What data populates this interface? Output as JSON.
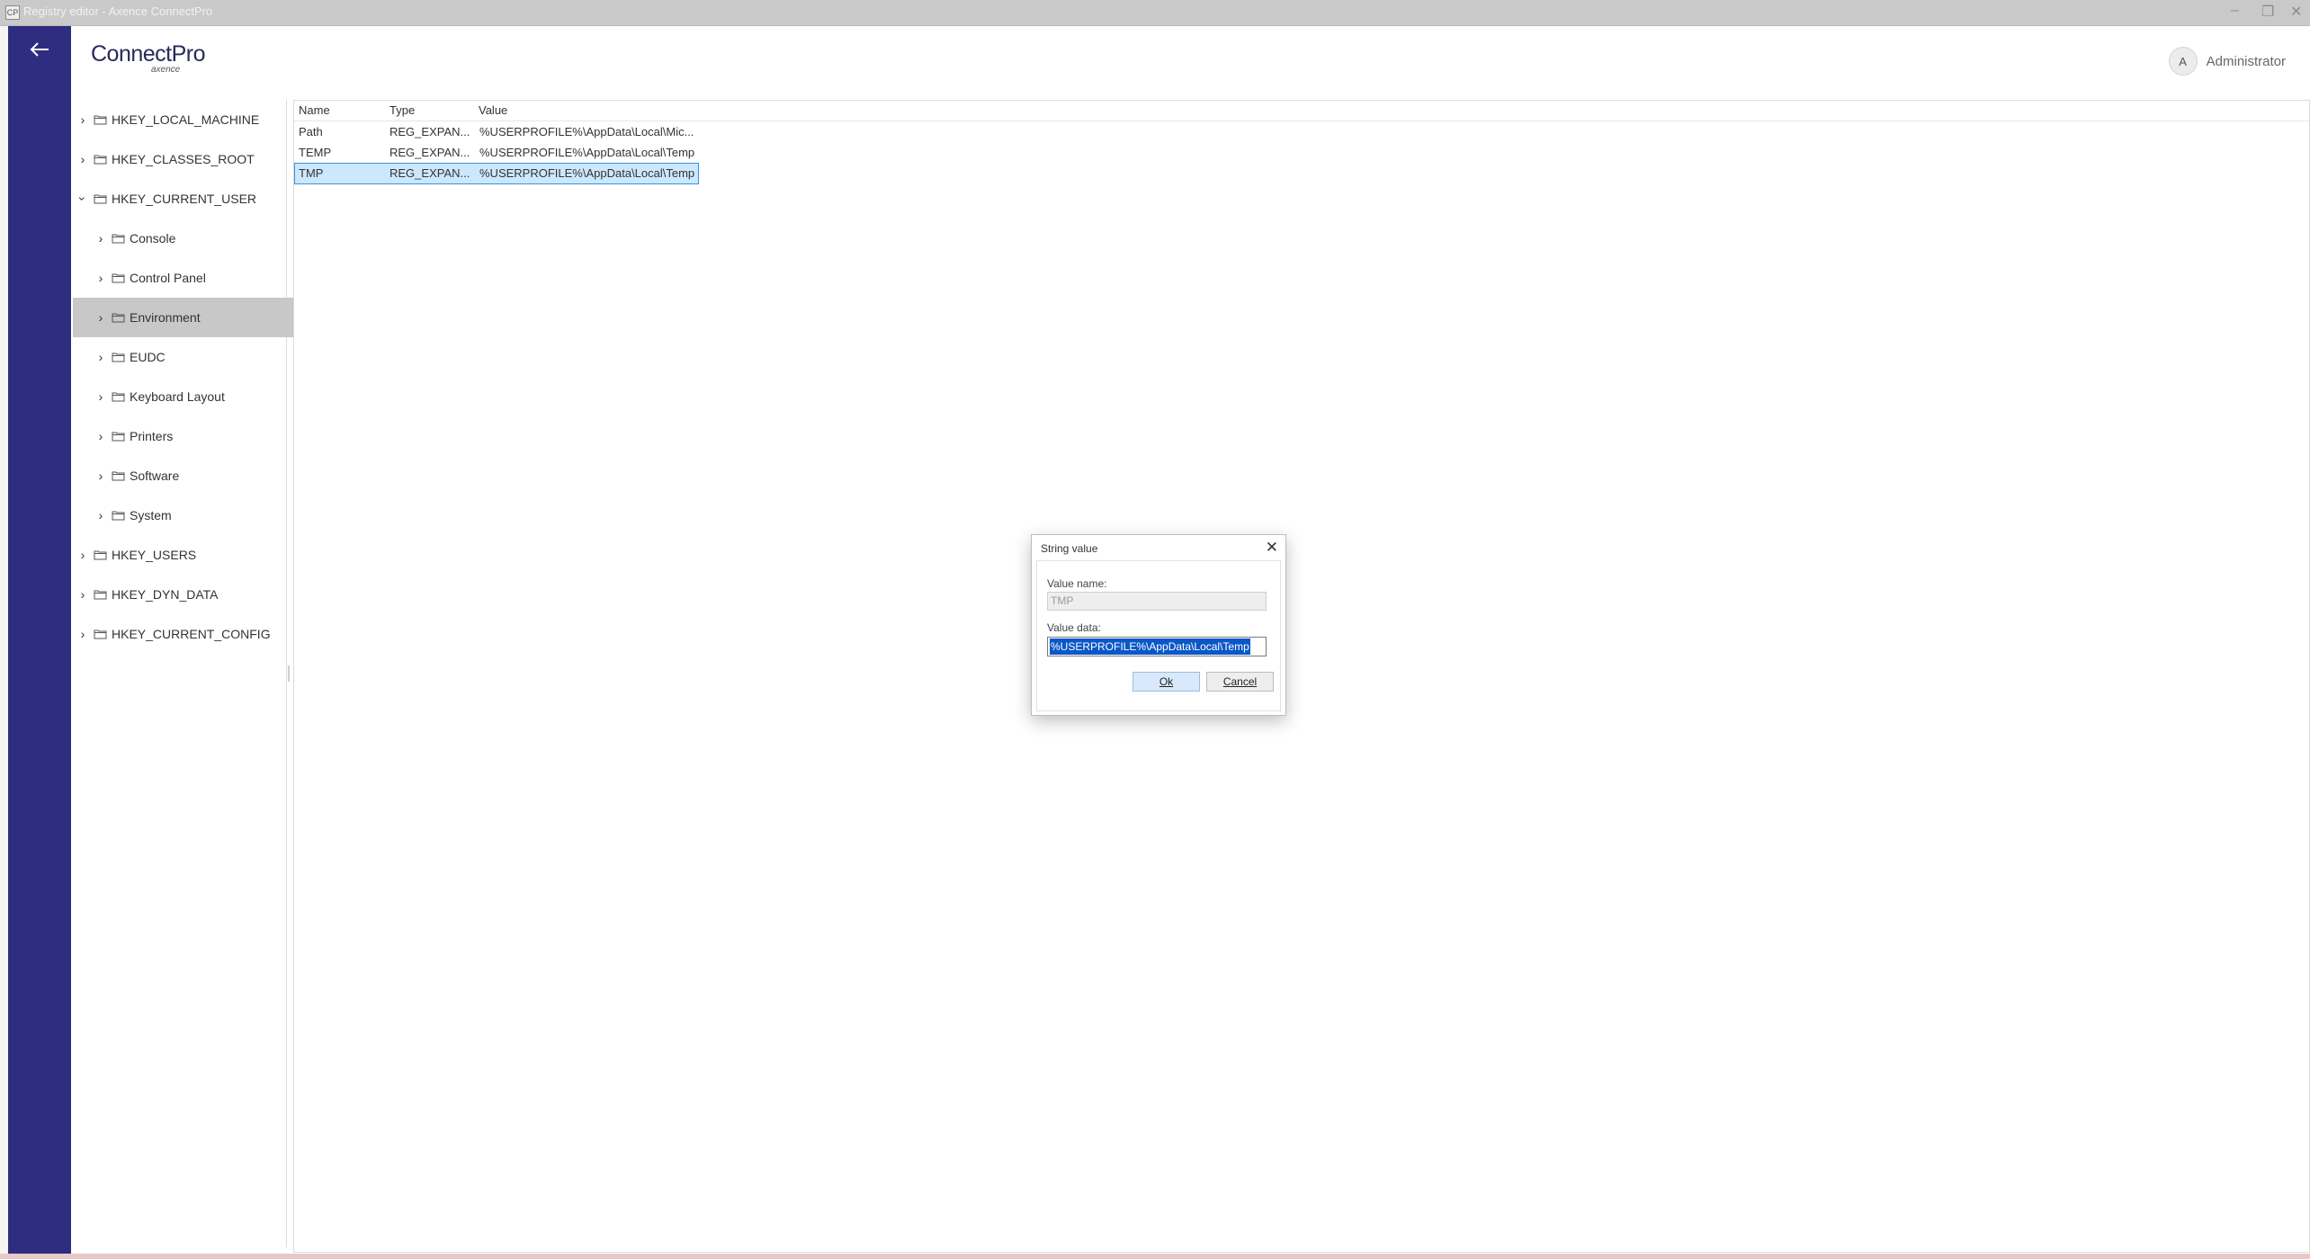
{
  "window": {
    "title": "Registry editor - Axence ConnectPro",
    "app_icon_text": "CP",
    "controls": [
      "minimize",
      "restore",
      "close"
    ]
  },
  "header": {
    "brand": "ConnectPro",
    "brand_sub": "axence",
    "user_initial": "A",
    "user_name": "Administrator"
  },
  "tree": {
    "items": [
      {
        "label": "HKEY_LOCAL_MACHINE",
        "level": 0,
        "expanded": false
      },
      {
        "label": "HKEY_CLASSES_ROOT",
        "level": 0,
        "expanded": false
      },
      {
        "label": "HKEY_CURRENT_USER",
        "level": 0,
        "expanded": true
      },
      {
        "label": "Console",
        "level": 1,
        "expanded": false
      },
      {
        "label": "Control Panel",
        "level": 1,
        "expanded": false
      },
      {
        "label": "Environment",
        "level": 1,
        "expanded": false,
        "selected": true
      },
      {
        "label": "EUDC",
        "level": 1,
        "expanded": false
      },
      {
        "label": "Keyboard Layout",
        "level": 1,
        "expanded": false
      },
      {
        "label": "Printers",
        "level": 1,
        "expanded": false
      },
      {
        "label": "Software",
        "level": 1,
        "expanded": false
      },
      {
        "label": "System",
        "level": 1,
        "expanded": false
      },
      {
        "label": "HKEY_USERS",
        "level": 0,
        "expanded": false
      },
      {
        "label": "HKEY_DYN_DATA",
        "level": 0,
        "expanded": false
      },
      {
        "label": "HKEY_CURRENT_CONFIG",
        "level": 0,
        "expanded": false
      }
    ]
  },
  "values": {
    "columns": [
      "Name",
      "Type",
      "Value"
    ],
    "rows": [
      {
        "name": "Path",
        "type": "REG_EXPAN...",
        "value": "%USERPROFILE%\\AppData\\Local\\Mic..."
      },
      {
        "name": "TEMP",
        "type": "REG_EXPAN...",
        "value": "%USERPROFILE%\\AppData\\Local\\Temp"
      },
      {
        "name": "TMP",
        "type": "REG_EXPAN...",
        "value": "%USERPROFILE%\\AppData\\Local\\Temp",
        "selected": true
      }
    ]
  },
  "dialog": {
    "title": "String value",
    "value_name_label": "Value name:",
    "value_name": "TMP",
    "value_data_label": "Value data:",
    "value_data": "%USERPROFILE%\\AppData\\Local\\Temp",
    "ok_label": "Ok",
    "cancel_label": "Cancel"
  },
  "colors": {
    "nav_rail": "#2e2d7f",
    "tree_selected": "#c8c8c8",
    "row_selected": "#cce8ff",
    "text_selection": "#0a57c8"
  }
}
